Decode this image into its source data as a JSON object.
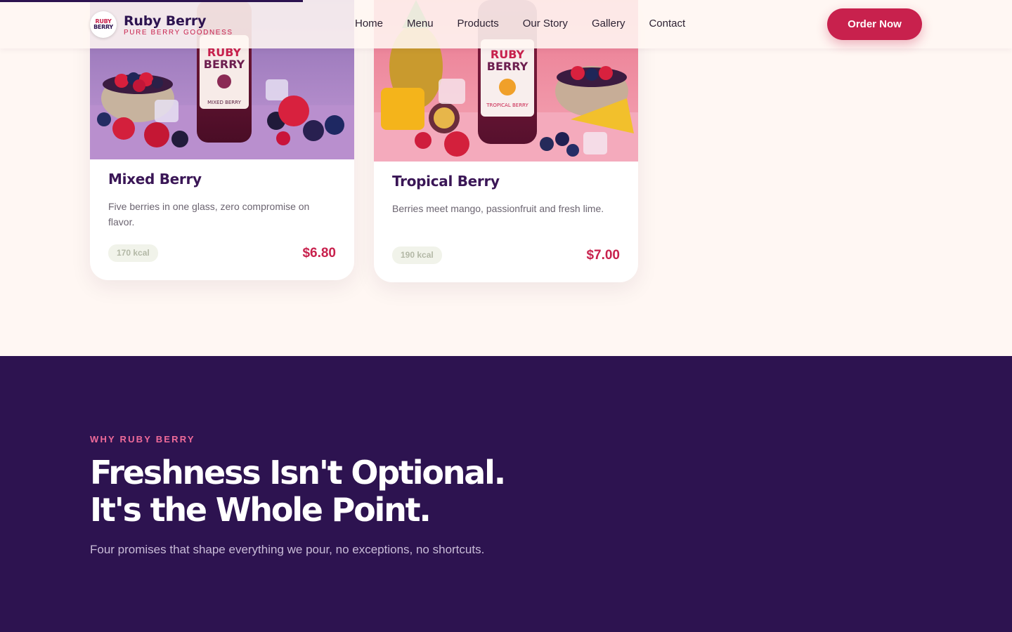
{
  "header": {
    "brand_name": "Ruby Berry",
    "brand_tagline": "PURE BERRY GOODNESS",
    "logo_text_top": "RUBY",
    "logo_text_bottom": "BERRY",
    "nav": [
      {
        "label": "Home"
      },
      {
        "label": "Menu"
      },
      {
        "label": "Products"
      },
      {
        "label": "Our Story"
      },
      {
        "label": "Gallery"
      },
      {
        "label": "Contact"
      }
    ],
    "cta_label": "Order Now"
  },
  "products": [
    {
      "name": "Mixed Berry",
      "description": "Five berries in one glass, zero compromise on flavor.",
      "kcal": "170 kcal",
      "price": "$6.80",
      "bottle_brand_top": "RUBY",
      "bottle_brand_bottom": "BERRY",
      "bottle_flavor": "MIXED BERRY"
    },
    {
      "name": "Tropical Berry",
      "description": "Berries meet mango, passionfruit and fresh lime.",
      "kcal": "190 kcal",
      "price": "$7.00",
      "bottle_brand_top": "RUBY",
      "bottle_brand_bottom": "BERRY",
      "bottle_flavor": "TROPICAL BERRY"
    }
  ],
  "why": {
    "eyebrow": "WHY RUBY BERRY",
    "heading_line1": "Freshness Isn't Optional.",
    "heading_line2": "It's the Whole Point.",
    "subtitle": "Four promises that shape everything we pour, no exceptions, no shortcuts."
  },
  "colors": {
    "brand_primary": "#c8214d",
    "brand_dark": "#2d1350",
    "page_bg": "#fff7f3"
  }
}
